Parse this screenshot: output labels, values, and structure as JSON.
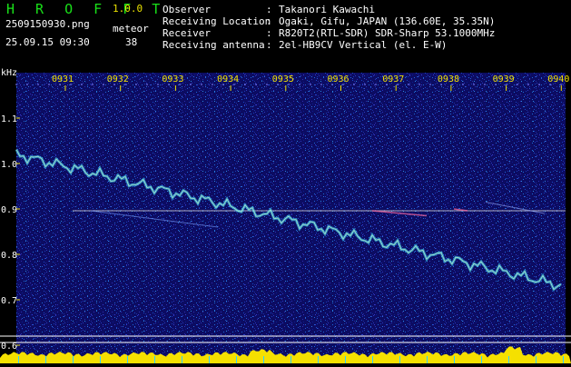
{
  "header": {
    "app_name": "H R O F F T",
    "version": "1.0.0",
    "file_name": "2509150930.png",
    "date_time": "25.09.15 09:30",
    "meteor_label": "meteor",
    "meteor_count": "38"
  },
  "info": [
    {
      "key": "Observer",
      "sep": ":",
      "value": "Takanori Kawachi"
    },
    {
      "key": "Receiving Location",
      "sep": ":",
      "value": "Ogaki, Gifu, JAPAN (136.60E, 35.35N)"
    },
    {
      "key": "Receiver",
      "sep": ":",
      "value": "R820T2(RTL-SDR) SDR-Sharp 53.1000MHz"
    },
    {
      "key": "Receiving antenna",
      "sep": ":",
      "value": "2el-HB9CV Vertical (el. E-W)"
    }
  ],
  "axis": {
    "y_unit": "kHz",
    "y_ticks": [
      "1.1",
      "1.0",
      "0.9",
      "0.8",
      "0.7",
      "0.6"
    ],
    "x_ticks": [
      "0931",
      "0932",
      "0933",
      "0934",
      "0935",
      "0936",
      "0937",
      "0938",
      "0939",
      "0940"
    ]
  },
  "colors": {
    "background": "#000000",
    "spectrogram_bg": "#0a0a5a",
    "title_green": "#19e019",
    "version_yellow": "#e8e000",
    "tick_yellow": "#f0e000",
    "signal_line": "#e0e0e0",
    "echo_cyan": "#40e0ff",
    "bottom_bar": "#f5e000"
  }
}
